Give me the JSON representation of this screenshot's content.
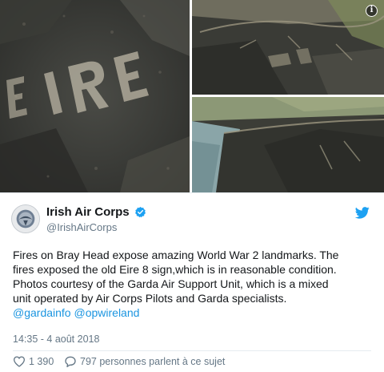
{
  "tweet": {
    "display_name": "Irish Air Corps",
    "handle": "@IrishAirCorps",
    "text_lines": [
      "Fires on Bray Head expose amazing World War 2 landmarks. The",
      "fires exposed the old Eire 8 sign,which is in reasonable condition.",
      "Photos courtesy of the Garda Air Support Unit, which is a mixed",
      "unit operated by Air Corps Pilots and Garda specialists."
    ],
    "mention_1": "@gardainfo",
    "mention_2": "@opwireland",
    "timestamp": "14:35 - 4 août 2018",
    "likes": "1 390",
    "replies": "797 personnes parlent à ce sujet"
  },
  "info_badge": "i",
  "icons": {
    "verified": "verified-badge-icon",
    "twitter": "twitter-bird-icon",
    "like": "heart-icon",
    "reply": "speech-bubble-icon",
    "info": "info-icon"
  },
  "colors": {
    "link": "#1b95e0",
    "twitter_blue": "#1da1f2",
    "secondary_text": "#657786",
    "primary_text": "#14171a"
  }
}
